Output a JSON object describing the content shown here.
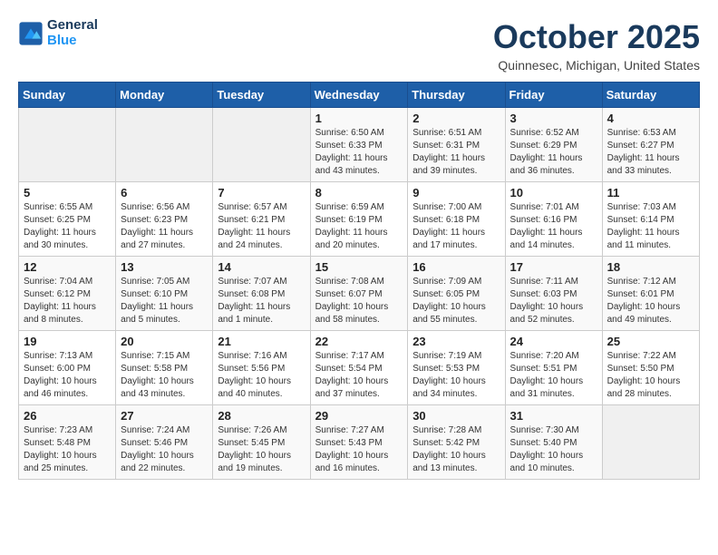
{
  "header": {
    "logo_line1": "General",
    "logo_line2": "Blue",
    "month": "October 2025",
    "location": "Quinnesec, Michigan, United States"
  },
  "weekdays": [
    "Sunday",
    "Monday",
    "Tuesday",
    "Wednesday",
    "Thursday",
    "Friday",
    "Saturday"
  ],
  "weeks": [
    [
      {
        "day": "",
        "sunrise": "",
        "sunset": "",
        "daylight": ""
      },
      {
        "day": "",
        "sunrise": "",
        "sunset": "",
        "daylight": ""
      },
      {
        "day": "",
        "sunrise": "",
        "sunset": "",
        "daylight": ""
      },
      {
        "day": "1",
        "sunrise": "Sunrise: 6:50 AM",
        "sunset": "Sunset: 6:33 PM",
        "daylight": "Daylight: 11 hours and 43 minutes."
      },
      {
        "day": "2",
        "sunrise": "Sunrise: 6:51 AM",
        "sunset": "Sunset: 6:31 PM",
        "daylight": "Daylight: 11 hours and 39 minutes."
      },
      {
        "day": "3",
        "sunrise": "Sunrise: 6:52 AM",
        "sunset": "Sunset: 6:29 PM",
        "daylight": "Daylight: 11 hours and 36 minutes."
      },
      {
        "day": "4",
        "sunrise": "Sunrise: 6:53 AM",
        "sunset": "Sunset: 6:27 PM",
        "daylight": "Daylight: 11 hours and 33 minutes."
      }
    ],
    [
      {
        "day": "5",
        "sunrise": "Sunrise: 6:55 AM",
        "sunset": "Sunset: 6:25 PM",
        "daylight": "Daylight: 11 hours and 30 minutes."
      },
      {
        "day": "6",
        "sunrise": "Sunrise: 6:56 AM",
        "sunset": "Sunset: 6:23 PM",
        "daylight": "Daylight: 11 hours and 27 minutes."
      },
      {
        "day": "7",
        "sunrise": "Sunrise: 6:57 AM",
        "sunset": "Sunset: 6:21 PM",
        "daylight": "Daylight: 11 hours and 24 minutes."
      },
      {
        "day": "8",
        "sunrise": "Sunrise: 6:59 AM",
        "sunset": "Sunset: 6:19 PM",
        "daylight": "Daylight: 11 hours and 20 minutes."
      },
      {
        "day": "9",
        "sunrise": "Sunrise: 7:00 AM",
        "sunset": "Sunset: 6:18 PM",
        "daylight": "Daylight: 11 hours and 17 minutes."
      },
      {
        "day": "10",
        "sunrise": "Sunrise: 7:01 AM",
        "sunset": "Sunset: 6:16 PM",
        "daylight": "Daylight: 11 hours and 14 minutes."
      },
      {
        "day": "11",
        "sunrise": "Sunrise: 7:03 AM",
        "sunset": "Sunset: 6:14 PM",
        "daylight": "Daylight: 11 hours and 11 minutes."
      }
    ],
    [
      {
        "day": "12",
        "sunrise": "Sunrise: 7:04 AM",
        "sunset": "Sunset: 6:12 PM",
        "daylight": "Daylight: 11 hours and 8 minutes."
      },
      {
        "day": "13",
        "sunrise": "Sunrise: 7:05 AM",
        "sunset": "Sunset: 6:10 PM",
        "daylight": "Daylight: 11 hours and 5 minutes."
      },
      {
        "day": "14",
        "sunrise": "Sunrise: 7:07 AM",
        "sunset": "Sunset: 6:08 PM",
        "daylight": "Daylight: 11 hours and 1 minute."
      },
      {
        "day": "15",
        "sunrise": "Sunrise: 7:08 AM",
        "sunset": "Sunset: 6:07 PM",
        "daylight": "Daylight: 10 hours and 58 minutes."
      },
      {
        "day": "16",
        "sunrise": "Sunrise: 7:09 AM",
        "sunset": "Sunset: 6:05 PM",
        "daylight": "Daylight: 10 hours and 55 minutes."
      },
      {
        "day": "17",
        "sunrise": "Sunrise: 7:11 AM",
        "sunset": "Sunset: 6:03 PM",
        "daylight": "Daylight: 10 hours and 52 minutes."
      },
      {
        "day": "18",
        "sunrise": "Sunrise: 7:12 AM",
        "sunset": "Sunset: 6:01 PM",
        "daylight": "Daylight: 10 hours and 49 minutes."
      }
    ],
    [
      {
        "day": "19",
        "sunrise": "Sunrise: 7:13 AM",
        "sunset": "Sunset: 6:00 PM",
        "daylight": "Daylight: 10 hours and 46 minutes."
      },
      {
        "day": "20",
        "sunrise": "Sunrise: 7:15 AM",
        "sunset": "Sunset: 5:58 PM",
        "daylight": "Daylight: 10 hours and 43 minutes."
      },
      {
        "day": "21",
        "sunrise": "Sunrise: 7:16 AM",
        "sunset": "Sunset: 5:56 PM",
        "daylight": "Daylight: 10 hours and 40 minutes."
      },
      {
        "day": "22",
        "sunrise": "Sunrise: 7:17 AM",
        "sunset": "Sunset: 5:54 PM",
        "daylight": "Daylight: 10 hours and 37 minutes."
      },
      {
        "day": "23",
        "sunrise": "Sunrise: 7:19 AM",
        "sunset": "Sunset: 5:53 PM",
        "daylight": "Daylight: 10 hours and 34 minutes."
      },
      {
        "day": "24",
        "sunrise": "Sunrise: 7:20 AM",
        "sunset": "Sunset: 5:51 PM",
        "daylight": "Daylight: 10 hours and 31 minutes."
      },
      {
        "day": "25",
        "sunrise": "Sunrise: 7:22 AM",
        "sunset": "Sunset: 5:50 PM",
        "daylight": "Daylight: 10 hours and 28 minutes."
      }
    ],
    [
      {
        "day": "26",
        "sunrise": "Sunrise: 7:23 AM",
        "sunset": "Sunset: 5:48 PM",
        "daylight": "Daylight: 10 hours and 25 minutes."
      },
      {
        "day": "27",
        "sunrise": "Sunrise: 7:24 AM",
        "sunset": "Sunset: 5:46 PM",
        "daylight": "Daylight: 10 hours and 22 minutes."
      },
      {
        "day": "28",
        "sunrise": "Sunrise: 7:26 AM",
        "sunset": "Sunset: 5:45 PM",
        "daylight": "Daylight: 10 hours and 19 minutes."
      },
      {
        "day": "29",
        "sunrise": "Sunrise: 7:27 AM",
        "sunset": "Sunset: 5:43 PM",
        "daylight": "Daylight: 10 hours and 16 minutes."
      },
      {
        "day": "30",
        "sunrise": "Sunrise: 7:28 AM",
        "sunset": "Sunset: 5:42 PM",
        "daylight": "Daylight: 10 hours and 13 minutes."
      },
      {
        "day": "31",
        "sunrise": "Sunrise: 7:30 AM",
        "sunset": "Sunset: 5:40 PM",
        "daylight": "Daylight: 10 hours and 10 minutes."
      },
      {
        "day": "",
        "sunrise": "",
        "sunset": "",
        "daylight": ""
      }
    ]
  ]
}
